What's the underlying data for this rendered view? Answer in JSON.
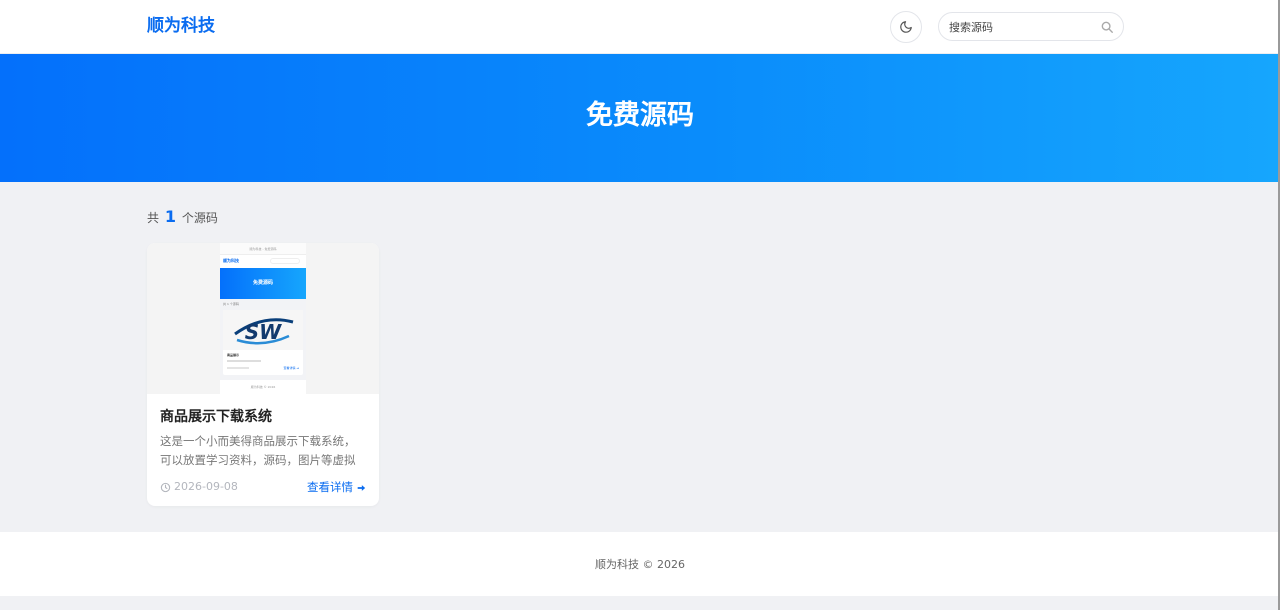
{
  "header": {
    "brand": "顺为科技",
    "search_placeholder": "搜索源码"
  },
  "hero": {
    "title": "免费源码"
  },
  "listing": {
    "count_prefix": "共",
    "count": "1",
    "count_suffix": "个源码"
  },
  "cards": [
    {
      "title": "商品展示下载系统",
      "description": "这是一个小而美得商品展示下载系统，可以放置学习资料，源码，图片等虚拟商...",
      "date": "2026-09-08",
      "link_label": "查看详情",
      "thumbnail": {
        "window_title": "顺为科技 - 免费源码",
        "brand": "顺为科技",
        "hero_title": "免费源码",
        "count_text": "共 1 个源码",
        "logo_text": "SW",
        "card_title": "商品展示",
        "link": "查看详情 ➔",
        "footer": "顺为科技 © 2026"
      }
    }
  ],
  "footer": {
    "copyright": "顺为科技 © 2026"
  },
  "colors": {
    "accent": "#0a6cf0",
    "hero_start": "#0470fb",
    "hero_end": "#16a6fd",
    "page_bg": "#f0f1f4"
  },
  "icons": {
    "theme_toggle": "moon-icon",
    "search": "search-icon",
    "date": "clock-icon",
    "link": "arrow-right-icon"
  }
}
